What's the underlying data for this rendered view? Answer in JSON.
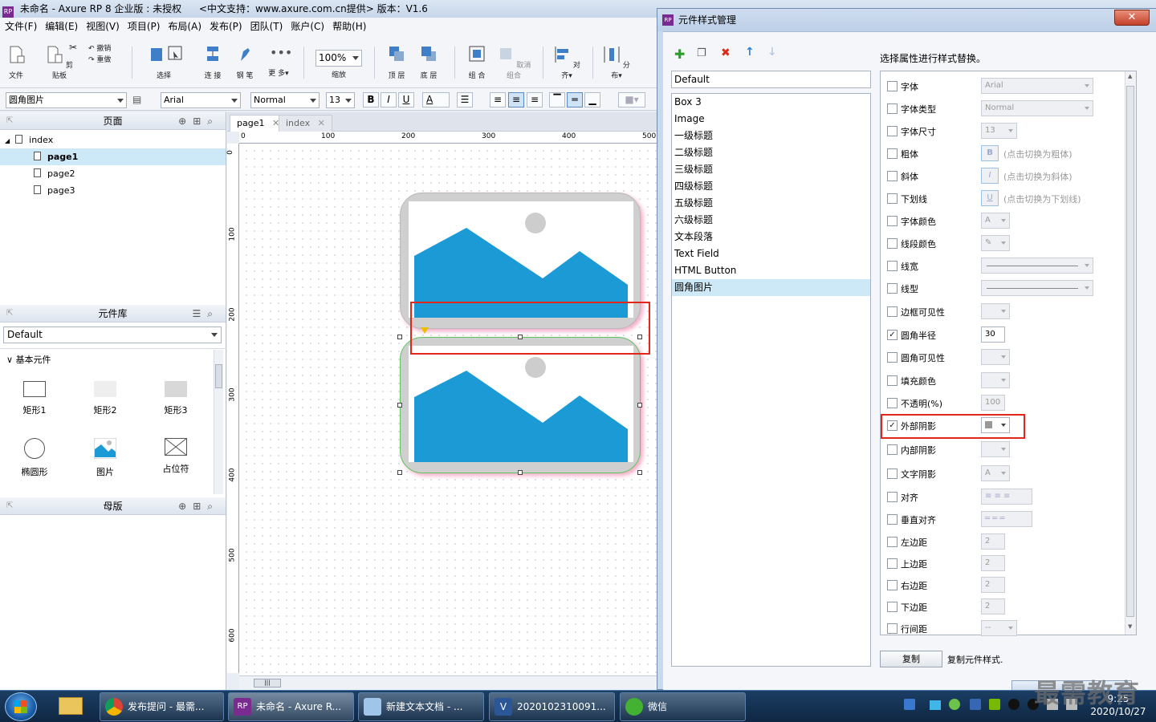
{
  "window": {
    "title": "未命名 - Axure RP 8 企业版 : 未授权",
    "subtitle": "<中文支持：www.axure.com.cn提供> 版本：V1.6",
    "logo": "RP"
  },
  "menu": [
    "文件(F)",
    "编辑(E)",
    "视图(V)",
    "项目(P)",
    "布局(A)",
    "发布(P)",
    "团队(T)",
    "账户(C)",
    "帮助(H)"
  ],
  "toolbar": {
    "file": "文件",
    "clipboard": "剪贴板",
    "undo": "撤销",
    "redo": "重做",
    "select": "选择",
    "connect": "连 接",
    "pen": "钢 笔",
    "more": "更 多▾",
    "zoom_value": "100%",
    "zoom": "缩放",
    "front": "顶 层",
    "back": "底 层",
    "group": "组 合",
    "ungroup": "取消 组合",
    "align": "对 齐▾",
    "distribute": "分 布▾"
  },
  "format": {
    "widget_style": "圆角图片",
    "font": "Arial",
    "font_type": "Normal",
    "font_size": "13",
    "bold": "B",
    "italic": "I",
    "underline": "U",
    "color": "A"
  },
  "pages": {
    "title": "页面",
    "root": "index",
    "items": [
      "page1",
      "page2",
      "page3"
    ]
  },
  "library": {
    "title": "元件库",
    "selected": "Default",
    "group": "基本元件",
    "widgets": [
      "矩形1",
      "矩形2",
      "矩形3",
      "椭圆形",
      "图片",
      "占位符"
    ]
  },
  "masters": {
    "title": "母版"
  },
  "tabs": [
    "page1",
    "index"
  ],
  "ruler": {
    "top": [
      "0",
      "100",
      "200",
      "300",
      "400",
      "500"
    ],
    "left": [
      "0",
      "100",
      "200",
      "300",
      "400",
      "500",
      "600"
    ]
  },
  "dialog": {
    "title": "元件样式管理",
    "close": "✕",
    "heading": "选择属性进行样式替换。",
    "default_name": "Default",
    "styles": [
      "Box 3",
      "Image",
      "一级标题",
      "二级标题",
      "三级标题",
      "四级标题",
      "五级标题",
      "六级标题",
      "文本段落",
      "Text Field",
      "HTML Button",
      "圆角图片"
    ],
    "selected_style": "圆角图片",
    "props": [
      {
        "label": "字体",
        "checked": false,
        "value": "Arial"
      },
      {
        "label": "字体类型",
        "checked": false,
        "value": "Normal"
      },
      {
        "label": "字体尺寸",
        "checked": false,
        "value": "13"
      },
      {
        "label": "粗体",
        "checked": false,
        "value": "B",
        "hint": "(点击切换为粗体)"
      },
      {
        "label": "斜体",
        "checked": false,
        "value": "I",
        "hint": "(点击切换为斜体)"
      },
      {
        "label": "下划线",
        "checked": false,
        "value": "U",
        "hint": "(点击切换为下划线)"
      },
      {
        "label": "字体颜色",
        "checked": false,
        "value": "A"
      },
      {
        "label": "线段颜色",
        "checked": false,
        "value": ""
      },
      {
        "label": "线宽",
        "checked": false,
        "value": ""
      },
      {
        "label": "线型",
        "checked": false,
        "value": ""
      },
      {
        "label": "边框可见性",
        "checked": false,
        "value": ""
      },
      {
        "label": "圆角半径",
        "checked": true,
        "value": "30"
      },
      {
        "label": "圆角可见性",
        "checked": false,
        "value": ""
      },
      {
        "label": "填充颜色",
        "checked": false,
        "value": ""
      },
      {
        "label": "不透明(%)",
        "checked": false,
        "value": "100"
      },
      {
        "label": "外部阴影",
        "checked": true,
        "value": ""
      },
      {
        "label": "内部阴影",
        "checked": false,
        "value": ""
      },
      {
        "label": "文字阴影",
        "checked": false,
        "value": "A"
      },
      {
        "label": "对齐",
        "checked": false,
        "value": ""
      },
      {
        "label": "垂直对齐",
        "checked": false,
        "value": ""
      },
      {
        "label": "左边距",
        "checked": false,
        "value": "2"
      },
      {
        "label": "上边距",
        "checked": false,
        "value": "2"
      },
      {
        "label": "右边距",
        "checked": false,
        "value": "2"
      },
      {
        "label": "下边距",
        "checked": false,
        "value": "2"
      },
      {
        "label": "行间距",
        "checked": false,
        "value": "--"
      }
    ],
    "copy_button": "复制",
    "copy_hint": "复制元件样式."
  },
  "taskbar": {
    "items": [
      "发布提问 - 最需...",
      "未命名 - Axure R...",
      "新建文本文档 - ...",
      "2020102310091...",
      "微信"
    ],
    "time": "9:25",
    "date": "2020/10/27",
    "watermark": "最需教育"
  },
  "colors": {
    "image_blue": "#1b9ad6",
    "selection_green": "#5ec55e",
    "highlight_red": "#e0271a",
    "selected_row": "#cde8f7"
  }
}
